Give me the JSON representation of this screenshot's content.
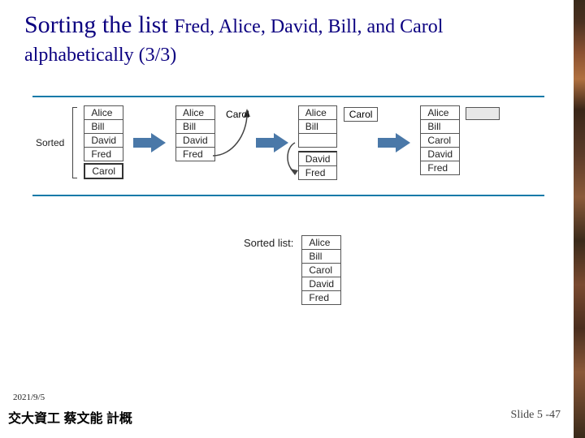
{
  "title": {
    "line1_main": "Sorting the list ",
    "line1_sub": "Fred, Alice, David, Bill, and Carol",
    "line2": "alphabetically (3/3)"
  },
  "labels": {
    "sorted_side": "Sorted",
    "sorted_list": "Sorted list:",
    "carol_float": "Carol"
  },
  "stages": {
    "s1": [
      "Alice",
      "Bill",
      "David",
      "Fred",
      "Carol"
    ],
    "s2": [
      "Alice",
      "Bill",
      "David",
      "Fred"
    ],
    "s3_top": [
      "Alice",
      "Bill"
    ],
    "s3_bottom": [
      "David",
      "Fred"
    ],
    "s4": [
      "Alice",
      "Bill",
      "Carol",
      "David",
      "Fred"
    ]
  },
  "final_sorted": [
    "Alice",
    "Bill",
    "Carol",
    "David",
    "Fred"
  ],
  "footer": {
    "date": "2021/9/5",
    "left": "交大資工 蔡文能 計概",
    "right": "Slide 5 -47"
  },
  "colors": {
    "title": "#0b0080",
    "rule": "#107aa8",
    "arrow": "#3a6aa0"
  }
}
